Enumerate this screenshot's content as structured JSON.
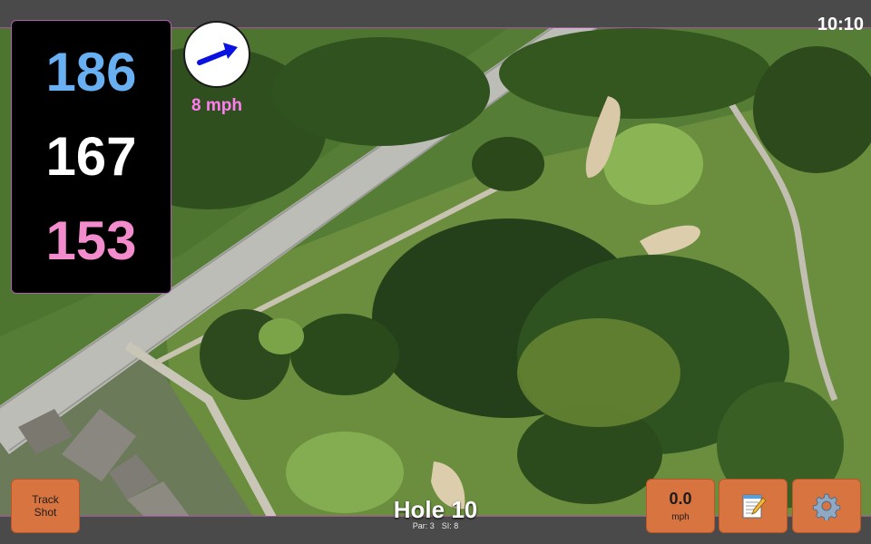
{
  "status_bar": {
    "time": "10:10"
  },
  "distances": {
    "back": "186",
    "middle": "167",
    "front": "153"
  },
  "wind": {
    "speed_label": "8 mph",
    "direction_icon": "wind-arrow-icon"
  },
  "buttons": {
    "track_shot": [
      "Track",
      "Shot"
    ],
    "wind_speed_value": "0.0",
    "wind_speed_unit": "mph",
    "notes_icon": "notepad-icon",
    "settings_icon": "gear-icon"
  },
  "hole": {
    "title": "Hole 10",
    "par": "Par: 3",
    "si": "SI: 8"
  },
  "colors": {
    "accent_frame": "#b060b0",
    "back_distance": "#69b0f2",
    "middle_distance": "#ffffff",
    "front_distance": "#f38ccd",
    "wind_label": "#ff7df0",
    "button": "#d8743f"
  }
}
